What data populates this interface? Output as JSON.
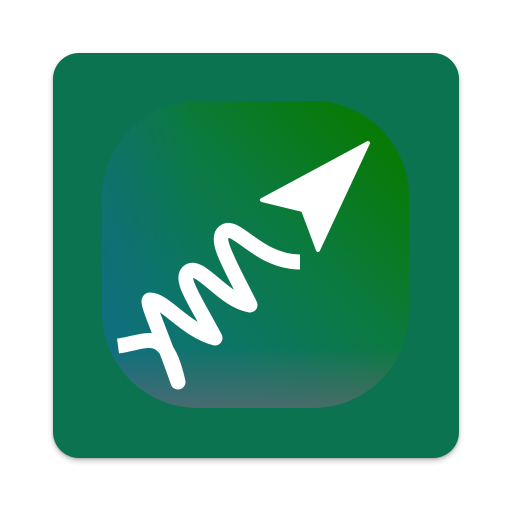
{
  "app_icon": {
    "icon": "spring-arrow-icon",
    "colors": {
      "outer_tile": "#0b7350",
      "inner_gradient_start": "#10717f",
      "inner_gradient_end": "#087a08",
      "glyph": "#ffffff"
    }
  }
}
